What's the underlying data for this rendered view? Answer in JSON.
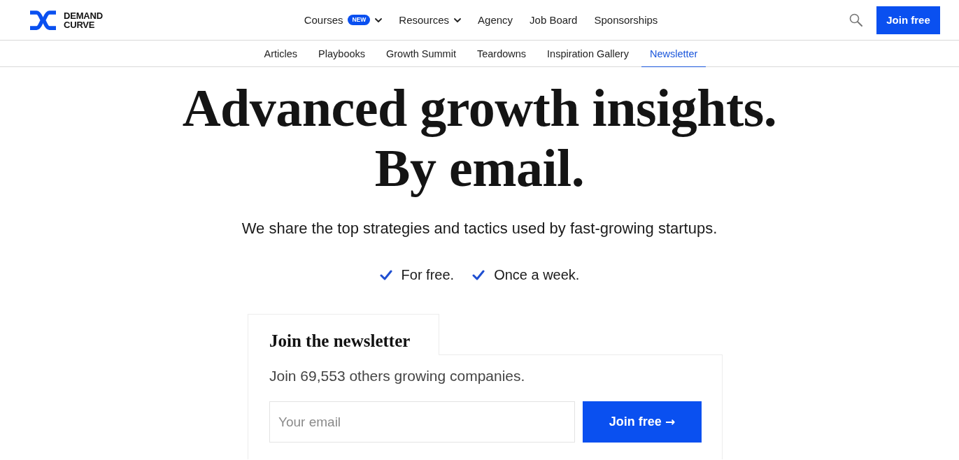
{
  "header": {
    "logo_text": [
      "DEMAND",
      "CURVE"
    ],
    "nav": [
      {
        "label": "Courses",
        "badge": "NEW",
        "dropdown": true
      },
      {
        "label": "Resources",
        "dropdown": true
      },
      {
        "label": "Agency",
        "dropdown": false
      },
      {
        "label": "Job Board",
        "dropdown": false
      },
      {
        "label": "Sponsorships",
        "dropdown": false
      }
    ],
    "join_button": "Join free"
  },
  "subnav": [
    {
      "label": "Articles",
      "selected": false
    },
    {
      "label": "Playbooks",
      "selected": false
    },
    {
      "label": "Growth Summit",
      "selected": false
    },
    {
      "label": "Teardowns",
      "selected": false
    },
    {
      "label": "Inspiration Gallery",
      "selected": false
    },
    {
      "label": "Newsletter",
      "selected": true
    }
  ],
  "hero": {
    "headline": [
      "Advanced growth insights.",
      "By email."
    ],
    "subtitle": "We share the top strategies and tactics used by fast-growing startups.",
    "perks": [
      "For free.",
      "Once a week."
    ]
  },
  "signup_card": {
    "title": "Join the newsletter",
    "description": "Join 69,553 others growing companies.",
    "email_field": {
      "placeholder": "Your email"
    },
    "submit_button": {
      "label": "Join free",
      "arrow": "→"
    }
  }
}
